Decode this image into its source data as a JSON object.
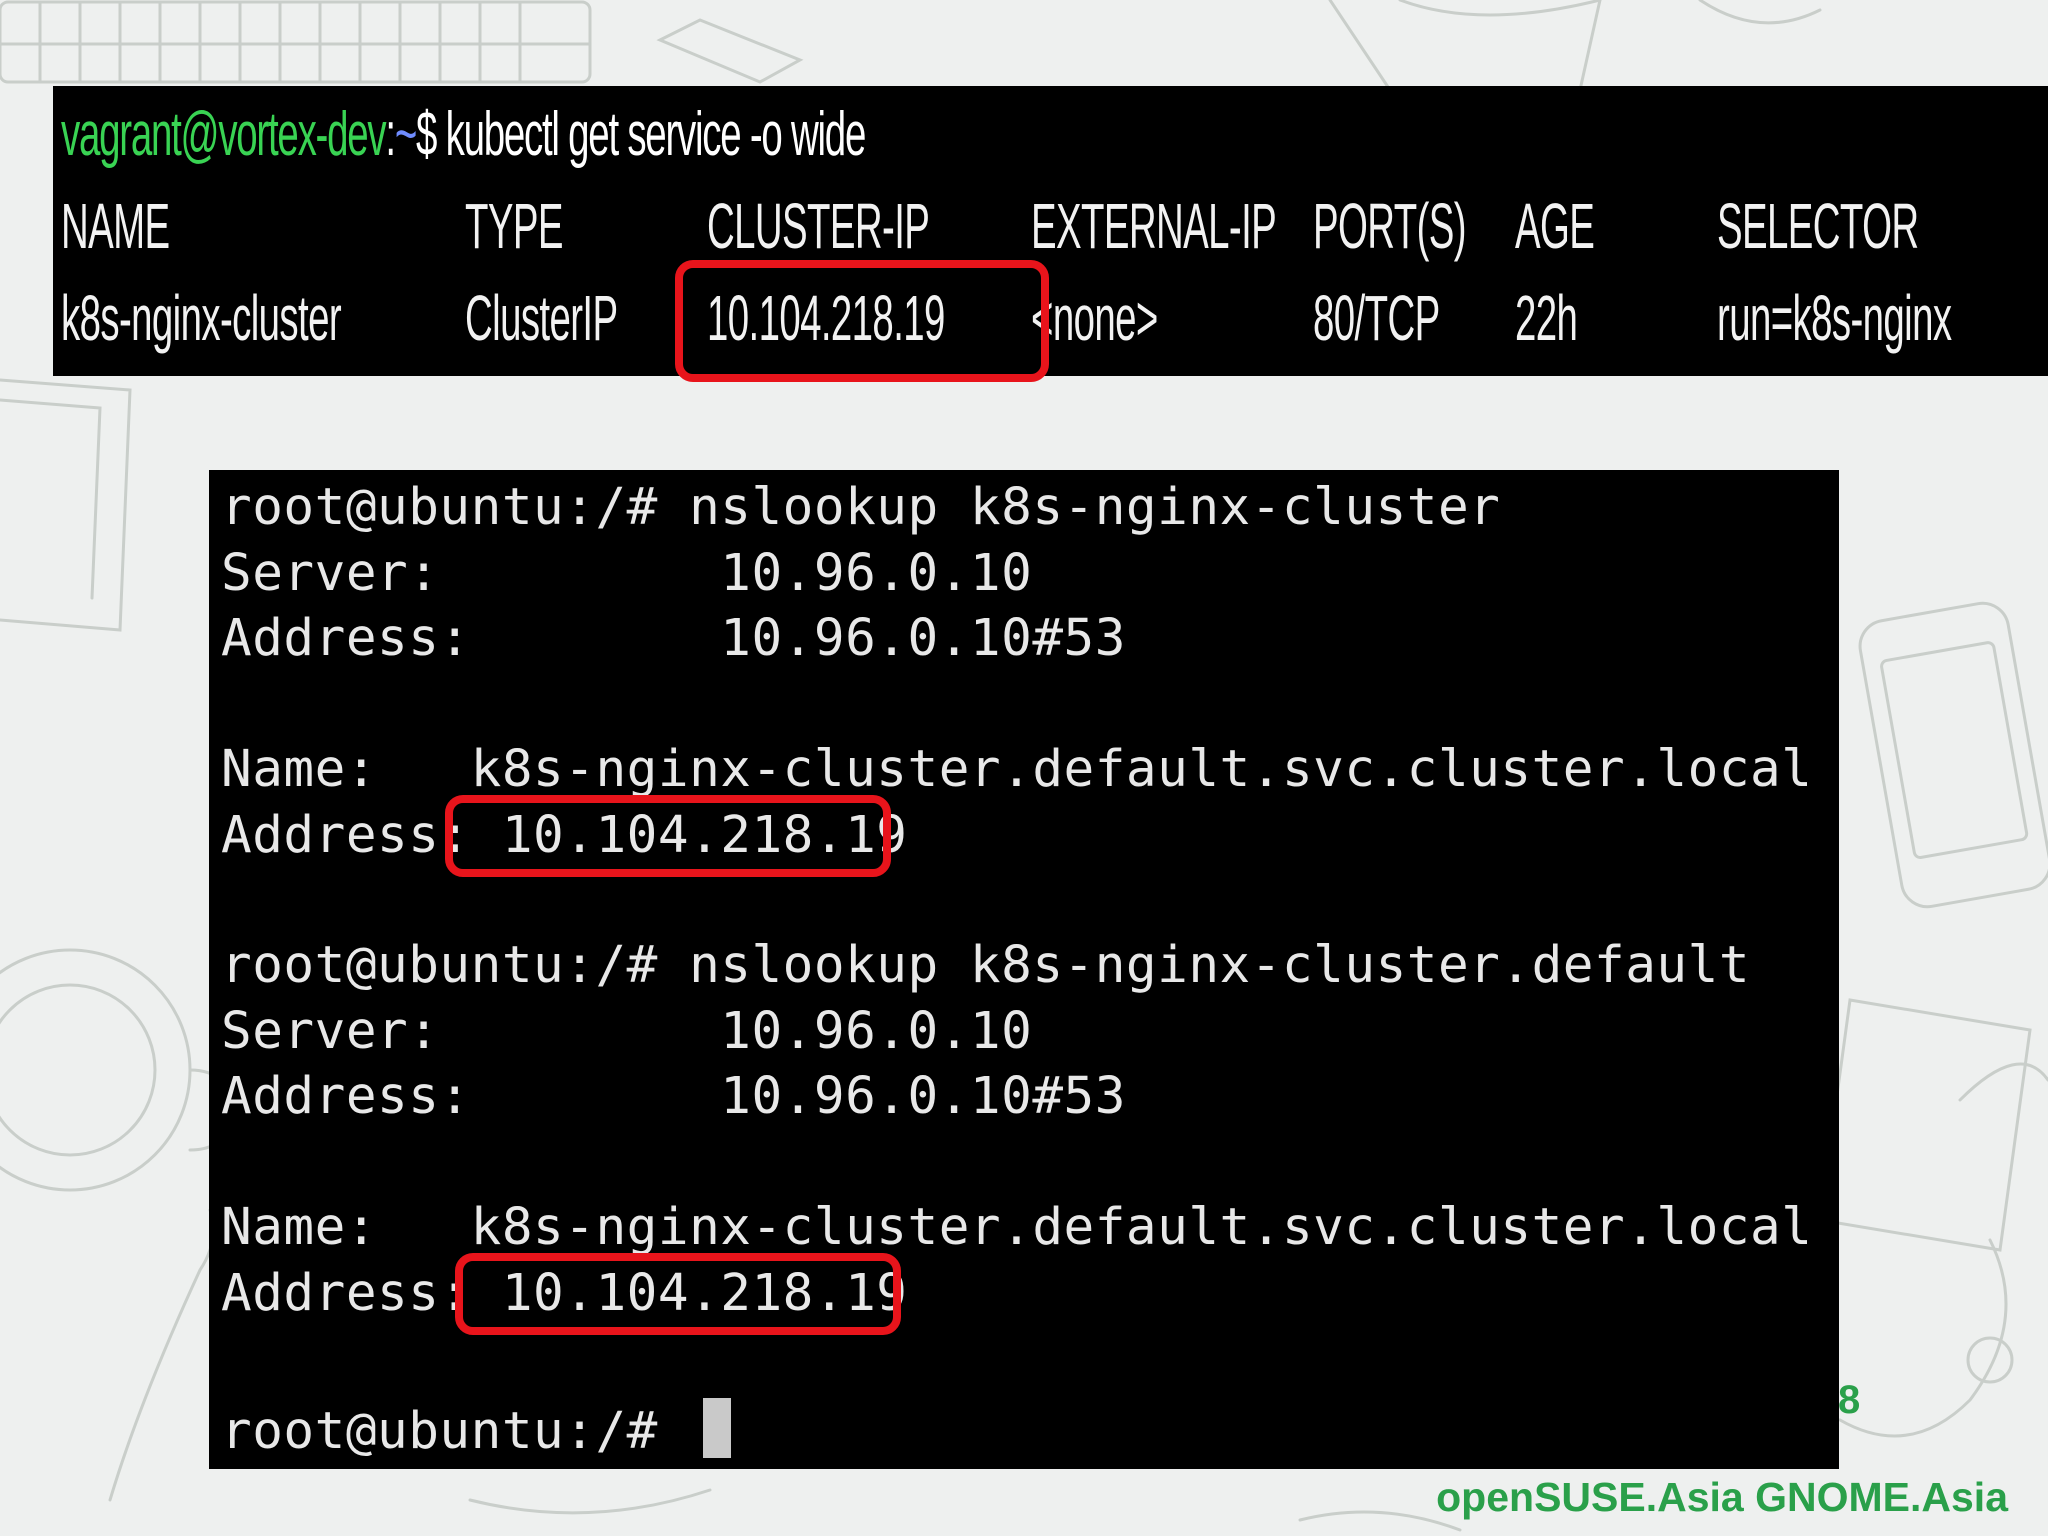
{
  "kubectl_terminal": {
    "prompt_user": "vagrant@vortex-dev",
    "prompt_sep": ":",
    "prompt_path": "~",
    "prompt_symbol": "$",
    "command": " kubectl get service -o wide",
    "columns": [
      "NAME",
      "TYPE",
      "CLUSTER-IP",
      "EXTERNAL-IP",
      "PORT(S)",
      "AGE",
      "SELECTOR"
    ],
    "row": [
      "k8s-nginx-cluster",
      "ClusterIP",
      "10.104.218.19",
      "<none>",
      "80/TCP",
      "22h",
      "run=k8s-nginx"
    ]
  },
  "nslookup_terminal": {
    "lines": [
      "root@ubuntu:/# nslookup k8s-nginx-cluster",
      "Server:         10.96.0.10",
      "Address:        10.96.0.10#53",
      "",
      "Name:   k8s-nginx-cluster.default.svc.cluster.local",
      "Address: 10.104.218.19",
      "",
      "root@ubuntu:/# nslookup k8s-nginx-cluster.default",
      "Server:         10.96.0.10",
      "Address:        10.96.0.10#53",
      "",
      "Name:   k8s-nginx-cluster.default.svc.cluster.local",
      "Address: 10.104.218.19",
      "",
      "root@ubuntu:/# "
    ]
  },
  "slide": {
    "page_number": "8",
    "footer": "openSUSE.Asia GNOME.Asia"
  },
  "colors": {
    "prompt_user": "#39d353",
    "prompt_path": "#6f8cff",
    "highlight": "#e8141b",
    "brand_green": "#2aa04a"
  }
}
